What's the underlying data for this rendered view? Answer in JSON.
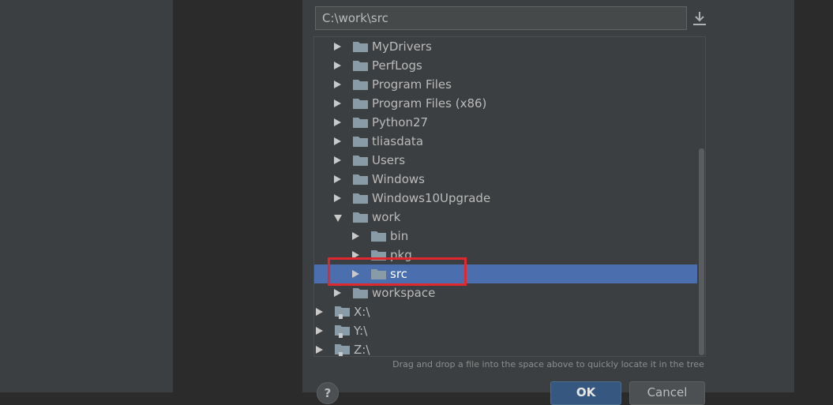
{
  "path_field": {
    "value": "C:\\work\\src"
  },
  "tree": {
    "items": [
      {
        "label": "MyDrivers",
        "icon": "folder-icon",
        "expanded": false,
        "selected": false
      },
      {
        "label": "PerfLogs",
        "icon": "folder-icon",
        "expanded": false,
        "selected": false
      },
      {
        "label": "Program Files",
        "icon": "folder-icon",
        "expanded": false,
        "selected": false
      },
      {
        "label": "Program Files (x86)",
        "icon": "folder-icon",
        "expanded": false,
        "selected": false
      },
      {
        "label": "Python27",
        "icon": "folder-icon",
        "expanded": false,
        "selected": false
      },
      {
        "label": "tliasdata",
        "icon": "folder-icon",
        "expanded": false,
        "selected": false
      },
      {
        "label": "Users",
        "icon": "folder-icon",
        "expanded": false,
        "selected": false
      },
      {
        "label": "Windows",
        "icon": "folder-icon",
        "expanded": false,
        "selected": false
      },
      {
        "label": "Windows10Upgrade",
        "icon": "folder-icon",
        "expanded": false,
        "selected": false
      },
      {
        "label": "work",
        "icon": "folder-icon",
        "expanded": true,
        "selected": false
      },
      {
        "label": "bin",
        "icon": "folder-icon",
        "expanded": false,
        "selected": false
      },
      {
        "label": "pkg",
        "icon": "folder-icon",
        "expanded": false,
        "selected": false
      },
      {
        "label": "src",
        "icon": "folder-icon",
        "expanded": false,
        "selected": true
      },
      {
        "label": "workspace",
        "icon": "folder-icon",
        "expanded": false,
        "selected": false
      },
      {
        "label": "X:\\",
        "icon": "drive-icon",
        "expanded": false,
        "selected": false
      },
      {
        "label": "Y:\\",
        "icon": "drive-icon",
        "expanded": false,
        "selected": false
      },
      {
        "label": "Z:\\",
        "icon": "drive-icon",
        "expanded": false,
        "selected": false
      }
    ]
  },
  "hint": "Drag and drop a file into the space above to quickly locate it in the tree",
  "buttons": {
    "help": "?",
    "ok": "OK",
    "cancel": "Cancel"
  },
  "colors": {
    "selection": "#4b6eaf",
    "highlight_box": "#e0282e",
    "folder": "#8a9ba8"
  }
}
